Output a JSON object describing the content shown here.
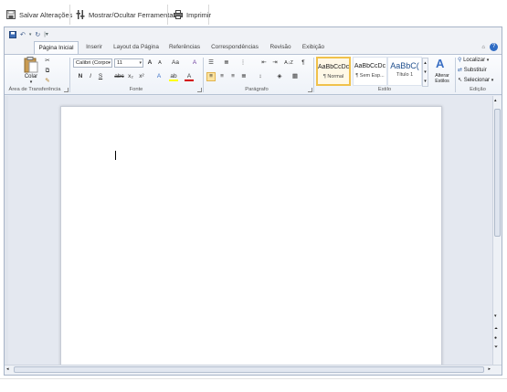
{
  "outer_toolbar": {
    "save_label": "Salvar Alterações",
    "toggle_tools_label": "Mostrar/Ocultar Ferramentas",
    "print_label": "Imprimir"
  },
  "tabs": [
    {
      "label": "Página Inicial",
      "active": true
    },
    {
      "label": "Inserir"
    },
    {
      "label": "Layout da Página"
    },
    {
      "label": "Referências"
    },
    {
      "label": "Correspondências"
    },
    {
      "label": "Revisão"
    },
    {
      "label": "Exibição"
    }
  ],
  "ribbon": {
    "clipboard": {
      "paste_label": "Colar",
      "group_label": "Área de Transferência"
    },
    "font": {
      "font_name": "Calibri (Corpo",
      "font_size": "11",
      "grow": "A",
      "shrink": "A",
      "change_case": "Aa",
      "clear_format": "A",
      "bold": "N",
      "italic": "I",
      "underline": "S",
      "strike": "abc",
      "subscript": "x₂",
      "superscript": "x²",
      "effects": "A",
      "highlight": "ab",
      "font_color": "A",
      "group_label": "Fonte"
    },
    "paragraph": {
      "sort": "A↓Z",
      "pilcrow": "¶",
      "group_label": "Parágrafo"
    },
    "styles": {
      "items": [
        {
          "sample": "AaBbCcDc",
          "name": "¶ Normal",
          "active": true
        },
        {
          "sample": "AaBbCcDc",
          "name": "¶ Sem Esp..."
        },
        {
          "sample": "AaBbC(",
          "name": "Título 1"
        }
      ],
      "change_styles_label": "Alterar Estilos",
      "group_label": "Estilo"
    },
    "editing": {
      "find_label": "Localizar",
      "replace_label": "Substituir",
      "select_label": "Selecionar",
      "group_label": "Edição"
    }
  },
  "colors": {
    "active_style_border": "#f0c14b",
    "highlight_yellow": "#ffff00",
    "font_color_red": "#d40000",
    "frame_border": "#a7b4c8"
  }
}
